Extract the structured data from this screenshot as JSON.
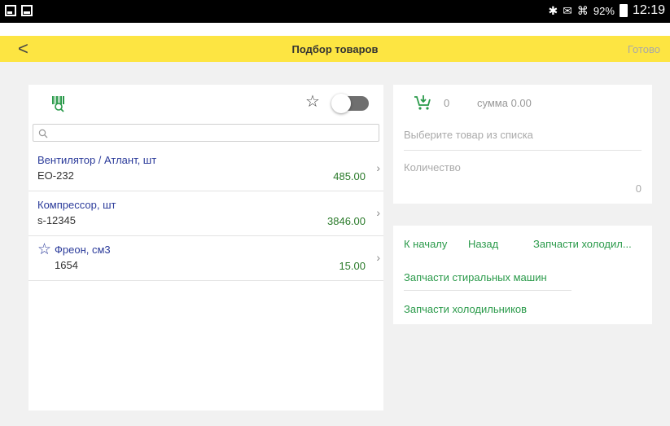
{
  "status_bar": {
    "battery": "92%",
    "time": "12:19"
  },
  "app_bar": {
    "back_symbol": "<",
    "title": "Подбор товаров",
    "done_label": "Готово"
  },
  "catalog": {
    "search": {
      "placeholder": "",
      "value": ""
    },
    "favorites_toggle_on": false,
    "items": [
      {
        "name": "Вентилятор / Атлант, шт",
        "code": "EO-232",
        "price": "485.00",
        "favorite": false
      },
      {
        "name": "Компрессор, шт",
        "code": "s-12345",
        "price": "3846.00",
        "favorite": false
      },
      {
        "name": "Фреон, см3",
        "code": "1654",
        "price": "15.00",
        "favorite": true
      }
    ]
  },
  "cart": {
    "count": "0",
    "sum": "сумма 0.00",
    "select_hint": "Выберите товар из списка",
    "quantity_label": "Количество",
    "quantity_value": "0"
  },
  "groups": {
    "to_start": "К началу",
    "back": "Назад",
    "current": "Запчасти холодил...",
    "items": [
      "Запчасти стиральных машин",
      "Запчасти холодильников"
    ]
  },
  "colors": {
    "accent_yellow": "#fde542",
    "link_green": "#2a9a4a",
    "item_blue": "#2a3a9a",
    "price_green": "#2a7a2a"
  }
}
